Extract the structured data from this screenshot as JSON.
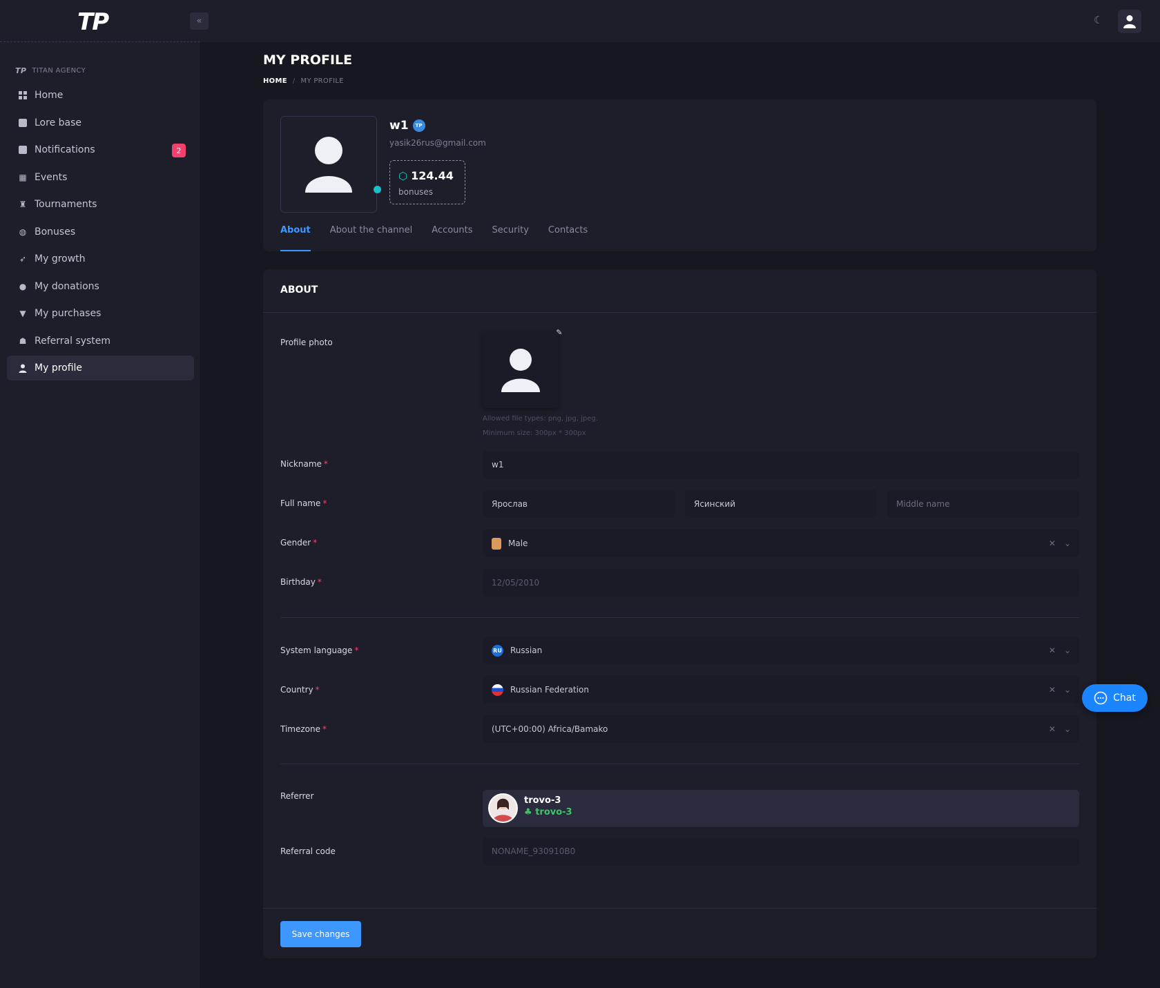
{
  "brand": {
    "logo": "TP",
    "section": "TITAN AGENCY",
    "section_logo": "TP"
  },
  "sidebar": {
    "items": [
      {
        "label": "Home",
        "icon": "grid-icon"
      },
      {
        "label": "Lore base",
        "icon": "book-icon"
      },
      {
        "label": "Notifications",
        "icon": "notification-icon",
        "badge": "2"
      },
      {
        "label": "Events",
        "icon": "calendar-icon"
      },
      {
        "label": "Tournaments",
        "icon": "trophy-icon"
      },
      {
        "label": "Bonuses",
        "icon": "coins-icon"
      },
      {
        "label": "My growth",
        "icon": "rocket-icon"
      },
      {
        "label": "My donations",
        "icon": "dollar-icon"
      },
      {
        "label": "My purchases",
        "icon": "cart-icon"
      },
      {
        "label": "Referral system",
        "icon": "people-icon"
      },
      {
        "label": "My profile",
        "icon": "user-icon",
        "active": true
      }
    ]
  },
  "header": {
    "title": "MY PROFILE",
    "breadcrumb_home": "HOME",
    "breadcrumb_sep": "/",
    "breadcrumb_current": "MY PROFILE"
  },
  "profile": {
    "name": "w1",
    "verified_badge": "TP",
    "email": "yasik26rus@gmail.com",
    "bonus_value": "124.44",
    "bonus_label": "bonuses",
    "tabs": [
      "About",
      "About the channel",
      "Accounts",
      "Security",
      "Contacts"
    ],
    "active_tab": "About"
  },
  "about": {
    "title": "ABOUT",
    "photo_label": "Profile photo",
    "photo_hint_1": "Allowed file types: png, jpg, jpeg.",
    "photo_hint_2": "Minimum size: 300px * 300px",
    "nickname_label": "Nickname",
    "nickname_value": "w1",
    "fullname_label": "Full name",
    "first_name": "Ярослав",
    "last_name": "Ясинский",
    "middle_name_placeholder": "Middle name",
    "gender_label": "Gender",
    "gender_value": "Male",
    "birthday_label": "Birthday",
    "birthday_value": "12/05/2010",
    "language_label": "System language",
    "language_value": "Russian",
    "language_code": "RU",
    "country_label": "Country",
    "country_value": "Russian Federation",
    "timezone_label": "Timezone",
    "timezone_value": "(UTC+00:00) Africa/Bamako",
    "referrer_label": "Referrer",
    "referrer_name": "trovo-3",
    "referrer_sub": "trovo-3",
    "refcode_label": "Referral code",
    "refcode_value": "NONAME_930910B0",
    "required_mark": "*",
    "save_label": "Save changes"
  },
  "chat": {
    "label": "Chat"
  },
  "colors": {
    "accent": "#3e97ff",
    "danger": "#f1416c",
    "online": "#17c1c9",
    "success": "#3cc46b"
  }
}
